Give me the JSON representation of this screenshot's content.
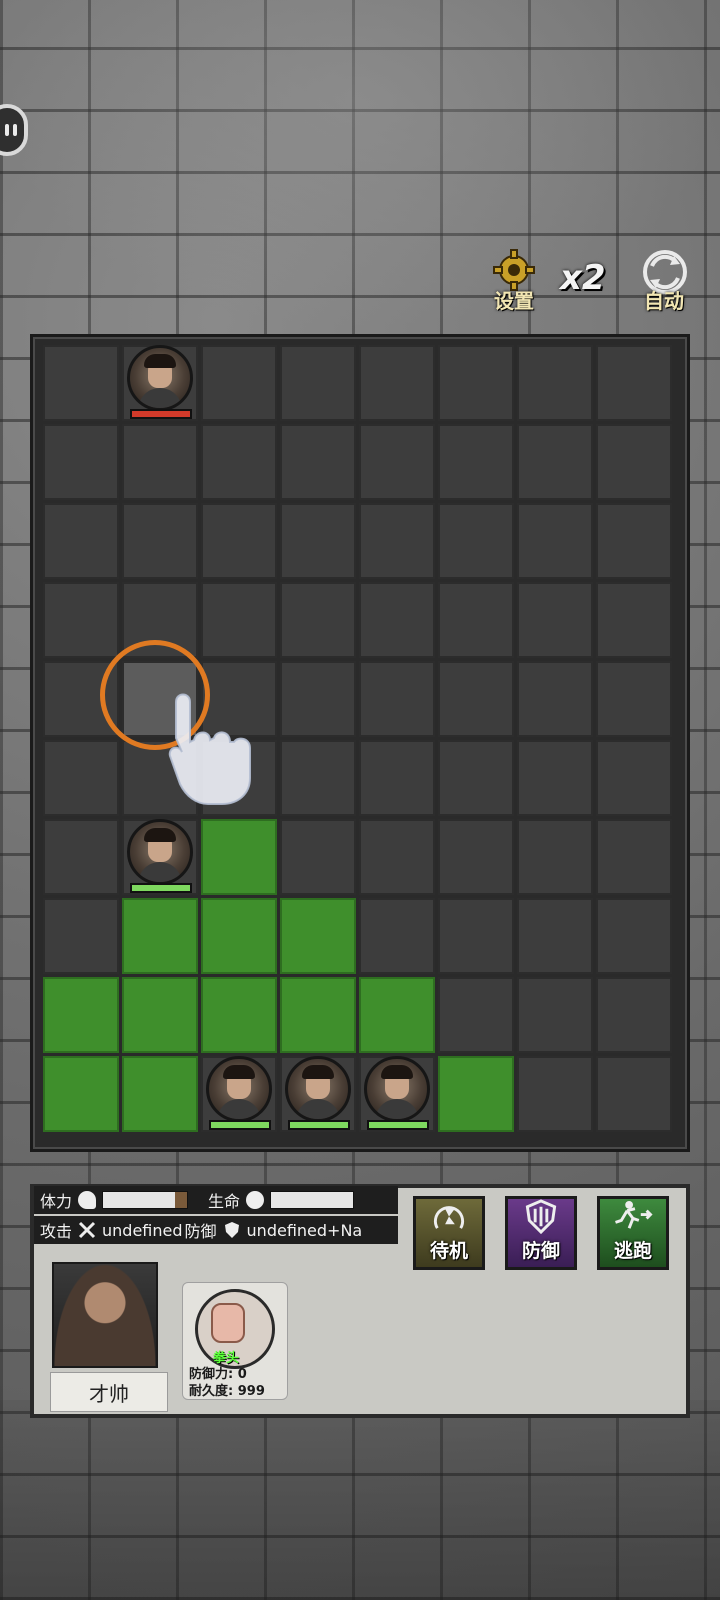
{
  "top_controls": {
    "settings_label": "设置",
    "speed_label": "x2",
    "auto_label": "自动"
  },
  "board": {
    "cols": 8,
    "rows": 10,
    "green_cells": [
      [
        2,
        6
      ],
      [
        1,
        7
      ],
      [
        2,
        7
      ],
      [
        3,
        7
      ],
      [
        0,
        8
      ],
      [
        1,
        8
      ],
      [
        2,
        8
      ],
      [
        3,
        8
      ],
      [
        4,
        8
      ],
      [
        0,
        9
      ],
      [
        1,
        9
      ],
      [
        5,
        9
      ]
    ],
    "highlight_cell": [
      1,
      4
    ],
    "units": [
      {
        "col": 1,
        "row": 0,
        "side": "enemy"
      },
      {
        "col": 1,
        "row": 6,
        "side": "ally"
      },
      {
        "col": 2,
        "row": 9,
        "side": "ally"
      },
      {
        "col": 3,
        "row": 9,
        "side": "ally"
      },
      {
        "col": 4,
        "row": 9,
        "side": "ally"
      }
    ]
  },
  "stats": {
    "stamina_label": "体力",
    "hp_label": "生命",
    "attack_label": "攻击",
    "attack_value": "undefined",
    "defense_label": "防御",
    "defense_value": "undefined+Na"
  },
  "actions": {
    "wait_label": "待机",
    "defend_label": "防御",
    "flee_label": "逃跑"
  },
  "character": {
    "name": "才帅"
  },
  "weapon": {
    "name": "拳头",
    "defense_text": "防御力: 0",
    "durability_text": "耐久度: 999"
  },
  "colors": {
    "green_cell": "#3f8f2c",
    "empty_cell": "#3d3d3d",
    "enemy_bar": "#d23a2a",
    "ally_bar": "#7ed85f",
    "tap_ring": "#e07a22"
  }
}
